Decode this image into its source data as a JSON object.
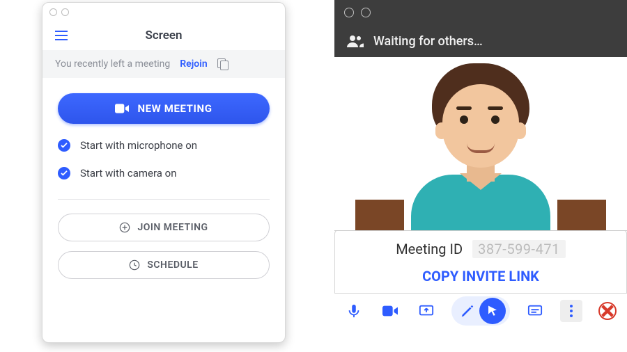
{
  "left": {
    "title": "Screen",
    "notice_text": "You recently left a meeting",
    "rejoin_label": "Rejoin",
    "new_meeting_label": "NEW MEETING",
    "option_mic_label": "Start with microphone on",
    "option_cam_label": "Start with camera on",
    "join_meeting_label": "JOIN MEETING",
    "schedule_label": "SCHEDULE"
  },
  "right": {
    "status_text": "Waiting for others…",
    "meeting_id_label": "Meeting ID",
    "meeting_id_value": "387-599-471",
    "copy_link_label": "COPY INVITE LINK"
  },
  "icons": {
    "camera": "camera-icon",
    "plus_circle": "plus-circle-icon",
    "clock": "clock-icon",
    "people": "people-icon",
    "mic": "mic-icon",
    "video": "video-icon",
    "share": "share-screen-icon",
    "pen": "pen-icon",
    "cursor": "cursor-icon",
    "chat": "chat-icon",
    "more": "more-icon",
    "close": "close-icon"
  },
  "colors": {
    "accent": "#2e5cff",
    "danger": "#d83a2b",
    "dark_header": "#3d3d3d"
  }
}
